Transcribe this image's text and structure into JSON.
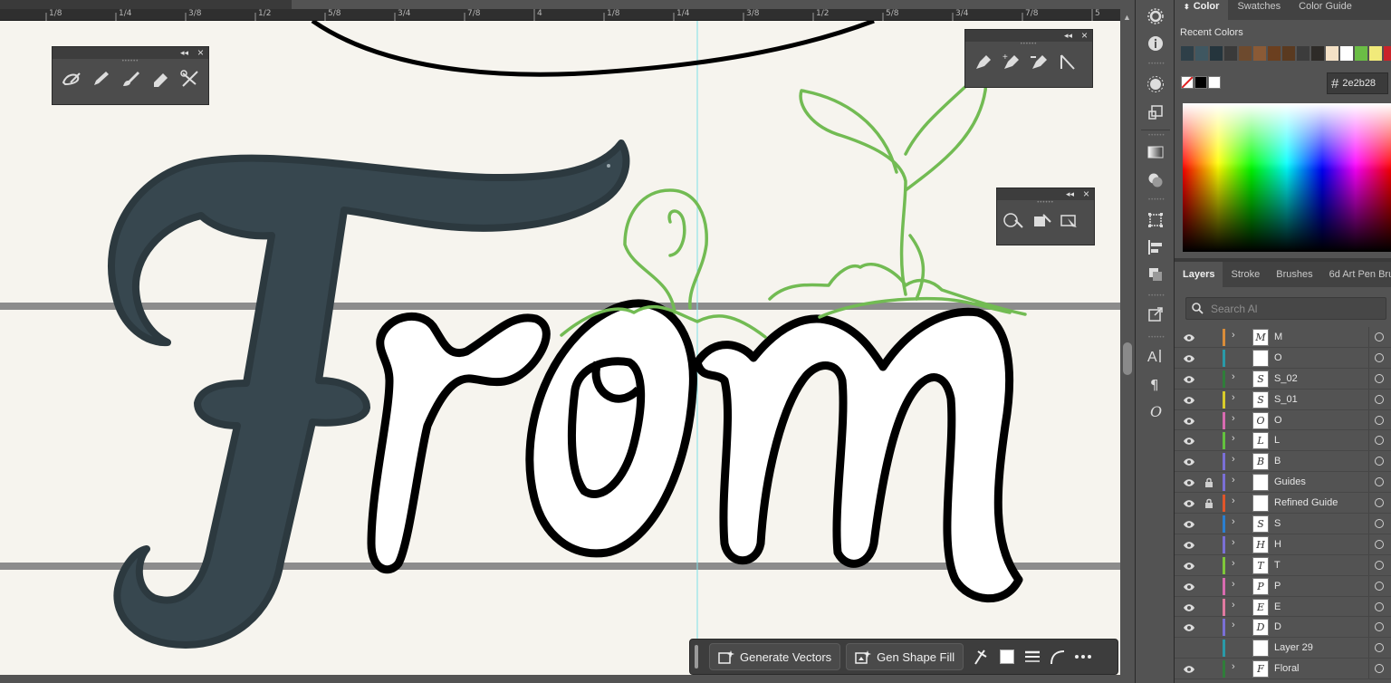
{
  "ruler": {
    "labels": [
      "1/8",
      "1/4",
      "3/8",
      "1/2",
      "5/8",
      "3/4",
      "7/8",
      "4",
      "1/8",
      "1/4",
      "3/8",
      "1/2",
      "5/8",
      "3/4",
      "7/8",
      "5"
    ]
  },
  "artwork": {
    "headline_shown": "From",
    "fill_color": "#37474f",
    "sprout_color": "#72bb53"
  },
  "floating_panels": {
    "brush_tools": [
      "blob-brush",
      "pencil",
      "paintbrush",
      "eraser",
      "scissors"
    ],
    "pen_tools": [
      "pen",
      "add-anchor",
      "delete-anchor",
      "anchor-point"
    ],
    "shape_tools": [
      "shape-builder",
      "live-paint-bucket",
      "live-paint-selection"
    ]
  },
  "color_panel": {
    "tabs": [
      "Color",
      "Swatches",
      "Color Guide"
    ],
    "active_tab": "Color",
    "recent_colors_label": "Recent Colors",
    "recent_colors": [
      "#2e3f48",
      "#3f5761",
      "#25353d",
      "#3a3a3a",
      "#6d4a2e",
      "#8a5a36",
      "#6b3f1f",
      "#5a3a20",
      "#3c3c3c",
      "#2e2b28",
      "#f4e1c6",
      "#ffffff",
      "#6bbd45",
      "#f1ea7a",
      "#c9242a"
    ],
    "hex_value": "2e2b28"
  },
  "layers_panel": {
    "tabs": [
      "Layers",
      "Stroke",
      "Brushes",
      "6d Art Pen Bru"
    ],
    "active_tab": "Layers",
    "search_placeholder": "Search Al",
    "layers": [
      {
        "name": "M",
        "color": "#d98c3a",
        "thumb": "M",
        "visible": true,
        "locked": false,
        "expandable": true
      },
      {
        "name": "O",
        "color": "#2a9aa8",
        "thumb": "",
        "visible": true,
        "locked": false,
        "expandable": false
      },
      {
        "name": "S_02",
        "color": "#2f7d3a",
        "thumb": "S",
        "visible": true,
        "locked": false,
        "expandable": true
      },
      {
        "name": "S_01",
        "color": "#d8cc2a",
        "thumb": "S",
        "visible": true,
        "locked": false,
        "expandable": true
      },
      {
        "name": "O",
        "color": "#d86bb0",
        "thumb": "O",
        "visible": true,
        "locked": false,
        "expandable": true
      },
      {
        "name": "L",
        "color": "#63c23e",
        "thumb": "L",
        "visible": true,
        "locked": false,
        "expandable": true
      },
      {
        "name": "B",
        "color": "#7a6fd6",
        "thumb": "B",
        "visible": true,
        "locked": false,
        "expandable": true
      },
      {
        "name": "Guides",
        "color": "#7a6fd6",
        "thumb": "",
        "visible": true,
        "locked": true,
        "expandable": true
      },
      {
        "name": "Refined Guide",
        "color": "#e0562a",
        "thumb": "",
        "visible": true,
        "locked": true,
        "expandable": true
      },
      {
        "name": "S",
        "color": "#2a7fd0",
        "thumb": "S",
        "visible": true,
        "locked": false,
        "expandable": true
      },
      {
        "name": "H",
        "color": "#7a6fd6",
        "thumb": "H",
        "visible": true,
        "locked": false,
        "expandable": true
      },
      {
        "name": "T",
        "color": "#7fc73a",
        "thumb": "T",
        "visible": true,
        "locked": false,
        "expandable": true
      },
      {
        "name": "P",
        "color": "#d86bb0",
        "thumb": "P",
        "visible": true,
        "locked": false,
        "expandable": true
      },
      {
        "name": "E",
        "color": "#e07aa0",
        "thumb": "E",
        "visible": true,
        "locked": false,
        "expandable": true
      },
      {
        "name": "D",
        "color": "#7a6fd6",
        "thumb": "D",
        "visible": true,
        "locked": false,
        "expandable": true
      },
      {
        "name": "Layer 29",
        "color": "#2a9aa8",
        "thumb": "",
        "visible": false,
        "locked": false,
        "expandable": false
      },
      {
        "name": "Floral",
        "color": "#2f7d3a",
        "thumb": "F",
        "visible": true,
        "locked": false,
        "expandable": true
      }
    ]
  },
  "contextual_bar": {
    "generate_vectors": "Generate Vectors",
    "gen_shape_fill": "Gen Shape Fill"
  }
}
